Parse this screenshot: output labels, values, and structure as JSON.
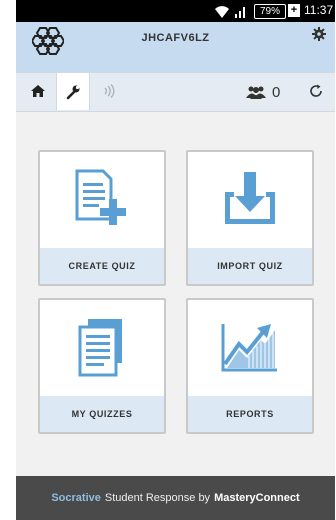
{
  "status_bar": {
    "battery": "79%",
    "battery_plus": "+",
    "time": "11:37"
  },
  "header": {
    "room_code": "JHCAFV6LZ"
  },
  "toolbar": {
    "student_count": "0"
  },
  "cards": {
    "create_quiz": "CREATE QUIZ",
    "import_quiz": "IMPORT QUIZ",
    "my_quizzes": "MY QUIZZES",
    "reports": "REPORTS"
  },
  "footer": {
    "brand": "Socrative",
    "middle": "Student Response by",
    "company": "MasteryConnect"
  },
  "colors": {
    "accent": "#5a9fd4",
    "header_bg": "#c6dbef",
    "card_label_bg": "#dce8f4",
    "footer_bg": "#4a4a4a"
  }
}
